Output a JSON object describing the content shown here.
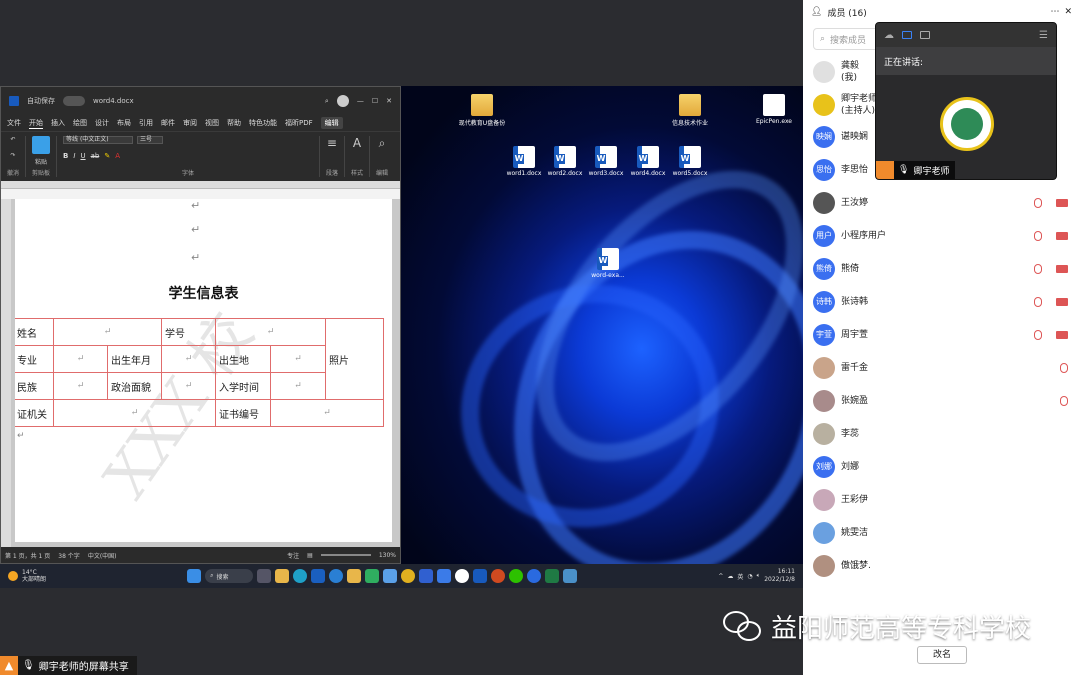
{
  "word": {
    "title_autosave": "自动保存",
    "doc_name": "word4.docx",
    "menu": [
      "文件",
      "开始",
      "插入",
      "绘图",
      "设计",
      "布局",
      "引用",
      "邮件",
      "审阅",
      "视图",
      "帮助",
      "特色功能",
      "福昕PDF"
    ],
    "edit_label": "编辑",
    "font_name": "等线 (中文正文)",
    "font_size": "三号",
    "ribbon_groups": [
      "撤消",
      "剪贴板",
      "字体",
      "段落",
      "样式",
      "编辑"
    ],
    "paste_label": "粘贴",
    "para_mark": "↵",
    "doc_title": "学生信息表",
    "watermark": "XXX 校",
    "table": {
      "r1": [
        "姓名",
        "学号"
      ],
      "r2": [
        "专业",
        "出生年月",
        "出生地",
        "照片"
      ],
      "r3": [
        "民族",
        "政治面貌",
        "入学时间"
      ],
      "r4": [
        "证机关",
        "证书编号"
      ]
    },
    "status": {
      "page": "第 1 页，共 1 页",
      "words": "38 个字",
      "lang": "中文(中国)",
      "focus": "专注",
      "zoom": "130%"
    }
  },
  "desktop": {
    "icons": [
      {
        "label": "现代教育U盘备份",
        "type": "folder"
      },
      {
        "label": "信息技术作业",
        "type": "folder"
      },
      {
        "label": "EpicPen.exe",
        "type": "pen"
      },
      {
        "label": "word1.docx",
        "type": "word"
      },
      {
        "label": "word2.docx",
        "type": "word"
      },
      {
        "label": "word3.docx",
        "type": "word"
      },
      {
        "label": "word4.docx",
        "type": "word"
      },
      {
        "label": "word5.docx",
        "type": "word"
      },
      {
        "label": "word-exa...",
        "type": "word"
      }
    ]
  },
  "taskbar": {
    "weather_temp": "14°C",
    "weather_desc": "大部晴朗",
    "search": "搜索",
    "ime": "英",
    "time": "16:11",
    "date": "2022/12/8"
  },
  "share_label": "卿宇老师的屏幕共享",
  "watermark_text": "益阳师范高等专科学校",
  "panel": {
    "title": "成员 (16)",
    "search_placeholder": "搜索成员",
    "rename": "改名",
    "members": [
      {
        "name": "龚毅",
        "sub": "(我)",
        "avatar": "",
        "color": "#e0e0e0",
        "mic": false
      },
      {
        "name": "卿宇老师",
        "sub": "(主持人)",
        "avatar": "",
        "color": "#e8c21a",
        "mic": false
      },
      {
        "name": "谌映娴",
        "avatar": "映娴",
        "color": "#3a6ff0",
        "mic": false
      },
      {
        "name": "李思怡",
        "avatar": "思怡",
        "color": "#3a6ff0",
        "mic": false
      },
      {
        "name": "王汝婷",
        "avatar": "",
        "color": "#555555",
        "mic": true
      },
      {
        "name": "小程序用户",
        "avatar": "用户",
        "color": "#3a6ff0",
        "mic": true
      },
      {
        "name": "熊倚",
        "avatar": "熊倚",
        "color": "#3a6ff0",
        "mic": true
      },
      {
        "name": "张诗韩",
        "avatar": "诗韩",
        "color": "#3a6ff0",
        "mic": true
      },
      {
        "name": "周宇萱",
        "avatar": "宇萱",
        "color": "#3a6ff0",
        "mic": true
      },
      {
        "name": "雷千金",
        "avatar": "",
        "color": "#c9a48a",
        "mic": true
      },
      {
        "name": "张婉盈",
        "avatar": "",
        "color": "#a88b8b",
        "mic": true
      },
      {
        "name": "李蕊",
        "avatar": "",
        "color": "#b8b0a0",
        "mic": false
      },
      {
        "name": "刘娜",
        "avatar": "刘娜",
        "color": "#3a6ff0",
        "mic": false
      },
      {
        "name": "王彩伊",
        "avatar": "",
        "color": "#c8a8b8",
        "mic": false
      },
      {
        "name": "姚雯洁",
        "avatar": "",
        "color": "#6aa0e0",
        "mic": false
      },
      {
        "name": "傲饿梦.",
        "avatar": "",
        "color": "#b09080",
        "mic": false
      }
    ]
  },
  "speaker": {
    "talking": "正在讲话:",
    "name": "卿宇老师"
  },
  "colors": {
    "accent": "#3a6ff0",
    "host": "#f08a2c",
    "word_blue": "#185abd"
  }
}
